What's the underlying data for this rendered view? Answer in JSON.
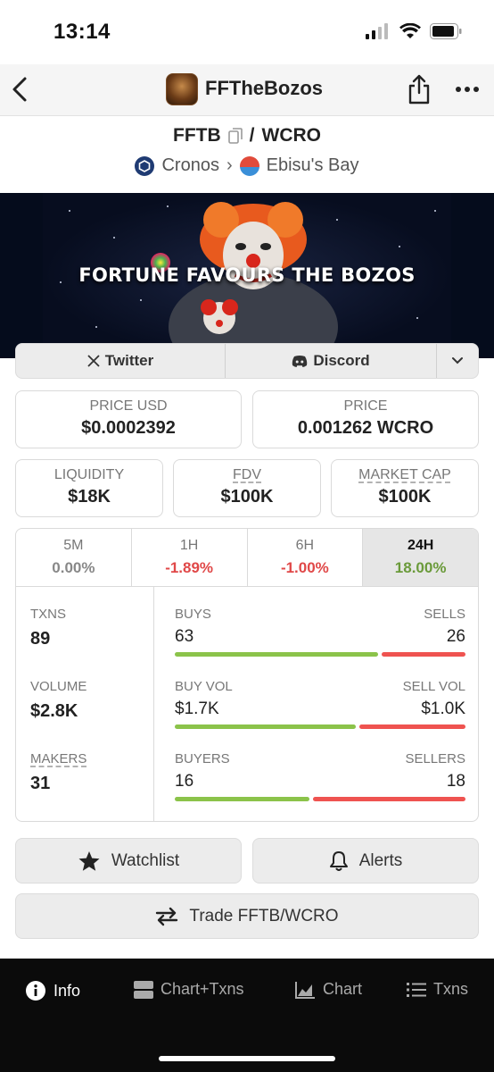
{
  "status": {
    "time": "13:14"
  },
  "header": {
    "title": "FFTheBozos"
  },
  "pair": {
    "base": "FFTB",
    "separator": "/",
    "quote": "WCRO",
    "chain": "Cronos",
    "dex": "Ebisu's Bay"
  },
  "banner": {
    "text": "FORTUNE FAVOURS THE BOZOS"
  },
  "socials": {
    "twitter": "Twitter",
    "discord": "Discord"
  },
  "prices": {
    "price_usd_label": "PRICE USD",
    "price_usd": "$0.0002392",
    "price_label": "PRICE",
    "price": "0.001262 WCRO"
  },
  "metrics": {
    "liquidity_label": "LIQUIDITY",
    "liquidity": "$18K",
    "fdv_label": "FDV",
    "fdv": "$100K",
    "mcap_label": "MARKET CAP",
    "mcap": "$100K"
  },
  "timeframes": [
    {
      "label": "5M",
      "value": "0.00%"
    },
    {
      "label": "1H",
      "value": "-1.89%"
    },
    {
      "label": "6H",
      "value": "-1.00%"
    },
    {
      "label": "24H",
      "value": "18.00%"
    }
  ],
  "stats": {
    "txns_label": "TXNS",
    "txns": "89",
    "volume_label": "VOLUME",
    "volume": "$2.8K",
    "makers_label": "MAKERS",
    "makers": "31",
    "buys_label": "BUYS",
    "buys": "63",
    "sells_label": "SELLS",
    "sells": "26",
    "buyvol_label": "BUY VOL",
    "buyvol": "$1.7K",
    "sellvol_label": "SELL VOL",
    "sellvol": "$1.0K",
    "buyers_label": "BUYERS",
    "buyers": "16",
    "sellers_label": "SELLERS",
    "sellers": "18",
    "buys_ratio": 0.708,
    "buyvol_ratio": 0.63,
    "buyers_ratio": 0.47
  },
  "actions": {
    "watchlist": "Watchlist",
    "alerts": "Alerts",
    "trade": "Trade FFTB/WCRO"
  },
  "nav": {
    "info": "Info",
    "chart_txns": "Chart+Txns",
    "chart": "Chart",
    "txns": "Txns"
  },
  "colors": {
    "positive": "#6a9a3a",
    "negative": "#e04848",
    "bar_green": "#8bc34a",
    "bar_red": "#ef5350"
  }
}
